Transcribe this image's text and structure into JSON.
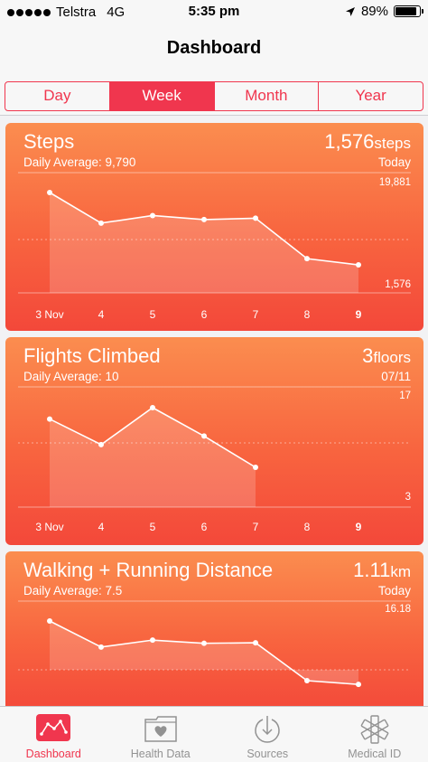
{
  "status": {
    "carrier": "Telstra",
    "network": "4G",
    "time": "5:35 pm",
    "battery": "89%",
    "battery_level": 0.89
  },
  "nav": {
    "title": "Dashboard"
  },
  "segments": [
    "Day",
    "Week",
    "Month",
    "Year"
  ],
  "segments_active": "Week",
  "accent": "#f0364e",
  "cards": [
    {
      "name": "Steps",
      "daily_average": "Daily Average: 9,790",
      "value": "1,576",
      "unit": "steps",
      "when": "Today",
      "y_max_label": "19,881",
      "y_min_label": "1,576",
      "x_labels": [
        "3 Nov",
        "4",
        "5",
        "6",
        "7",
        "8",
        "9"
      ],
      "chart_data": {
        "type": "area",
        "x": [
          "3 Nov",
          "4",
          "5",
          "6",
          "7",
          "8",
          "9"
        ],
        "values": [
          19881,
          13000,
          14700,
          13800,
          14100,
          5000,
          3600
        ],
        "ylim": [
          1576,
          19881
        ]
      }
    },
    {
      "name": "Flights Climbed",
      "daily_average": "Daily Average: 10",
      "value": "3",
      "unit": "floors",
      "when": "07/11",
      "y_max_label": "17",
      "y_min_label": "3",
      "x_labels": [
        "3 Nov",
        "4",
        "5",
        "6",
        "7",
        "8",
        "9"
      ],
      "chart_data": {
        "type": "area",
        "x": [
          "3 Nov",
          "4",
          "5",
          "6",
          "7"
        ],
        "values": [
          15,
          10.5,
          17,
          12,
          6.5
        ],
        "ylim": [
          3,
          17
        ]
      }
    },
    {
      "name": "Walking + Running Distance",
      "daily_average": "Daily Average: 7.5",
      "value": "1.11",
      "unit": "km",
      "when": "Today",
      "y_max_label": "16.18",
      "x_labels": [
        "3 Nov",
        "4",
        "5",
        "6",
        "7",
        "8",
        "9"
      ],
      "chart_data": {
        "type": "area",
        "x": [
          "3 Nov",
          "4",
          "5",
          "6",
          "7",
          "8",
          "9"
        ],
        "values": [
          16.18,
          11.3,
          12.6,
          12.0,
          12.1,
          5.0,
          4.3
        ],
        "ylim": [
          1.11,
          16.18
        ]
      }
    }
  ],
  "tabs": [
    {
      "label": "Dashboard",
      "icon": "dashboard-chart-icon",
      "active": true
    },
    {
      "label": "Health Data",
      "icon": "folder-heart-icon",
      "active": false
    },
    {
      "label": "Sources",
      "icon": "download-heart-icon",
      "active": false
    },
    {
      "label": "Medical ID",
      "icon": "asterisk-icon",
      "active": false
    }
  ]
}
